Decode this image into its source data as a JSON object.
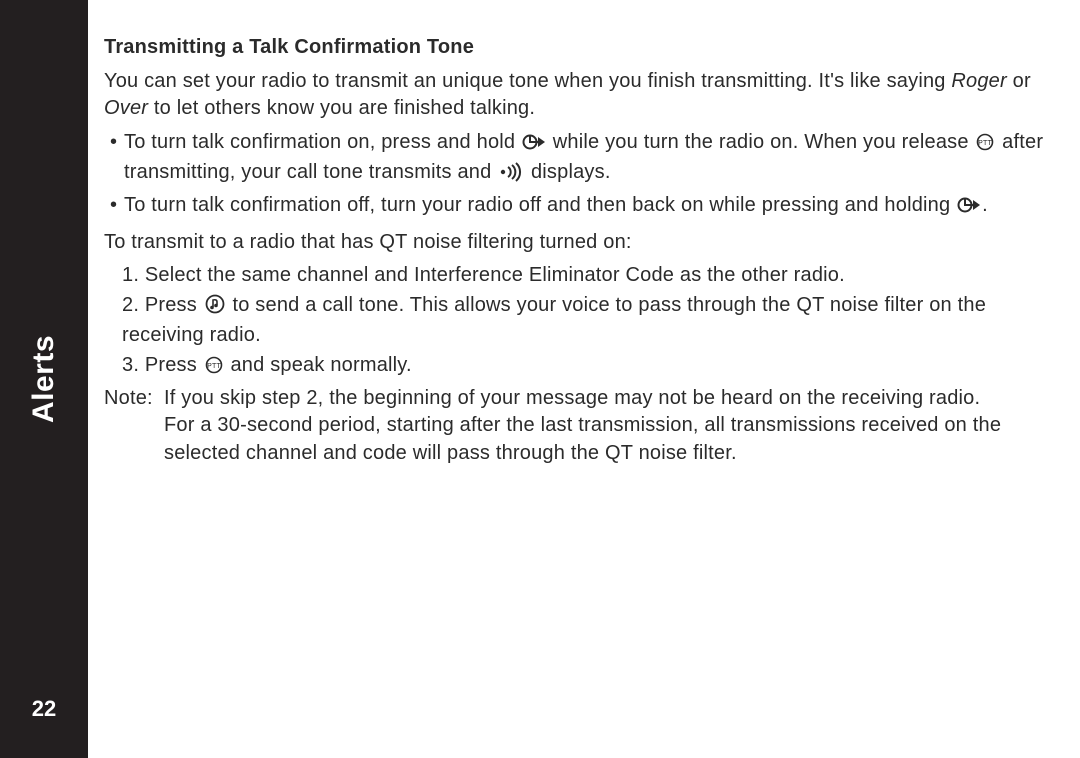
{
  "sidebar": {
    "section_title": "Alerts",
    "page_number": "22"
  },
  "content": {
    "heading": "Transmitting a Talk Confirmation Tone",
    "intro_1": "You can set your radio to transmit an unique tone when you finish transmitting. It's like saying ",
    "intro_roger": "Roger",
    "intro_or": " or ",
    "intro_over": "Over",
    "intro_2": " to let others know you are finished talking.",
    "bullet1_a": "To turn talk confirmation on, press and hold ",
    "bullet1_b": " while you turn the radio on. When you release ",
    "bullet1_c": " after transmitting, your call tone transmits and ",
    "bullet1_d": " displays.",
    "bullet2_a": "To turn talk confirmation off, turn your radio off and then back on while pressing and holding ",
    "bullet2_b": ".",
    "qt_intro": "To transmit to a radio that has QT noise filtering turned on:",
    "step1": "1. Select the same channel and Interference Eliminator Code as the other radio.",
    "step2_a": "2. Press ",
    "step2_b": " to send a call tone. This allows your voice to pass through the QT noise filter on the receiving radio.",
    "step3_a": "3. Press ",
    "step3_b": " and speak normally.",
    "note_a": "Note: If you skip step 2, the beginning of your message may not be heard on the receiving radio.",
    "note_b": "For a 30-second period, starting after the last transmission, all transmissions received on the selected channel and code will pass through the QT noise filter."
  }
}
